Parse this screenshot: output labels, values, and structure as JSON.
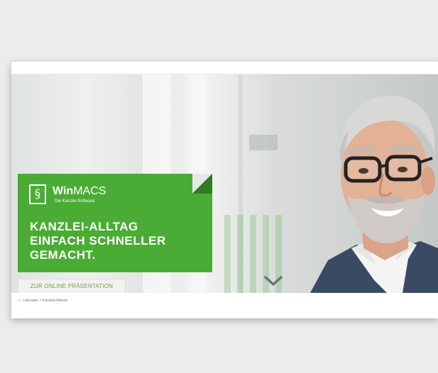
{
  "brand": {
    "name_bold": "Win",
    "name_light": "MACS",
    "tagline": "Die Kanzlei-Software",
    "logo_glyph": "§",
    "accent_color": "#4aac34"
  },
  "hero": {
    "headline_lines": [
      "KANZLEI-ALLTAG",
      "EINFACH SCHNELLER",
      "GEMACHT."
    ],
    "cta_label": "ZUR ONLINE PRÄSENTATION",
    "scroll_icon": "chevron-down-icon"
  },
  "breadcrumb": {
    "home_icon": "home-icon",
    "text": "Lösungen > Kanzleisoftware"
  }
}
